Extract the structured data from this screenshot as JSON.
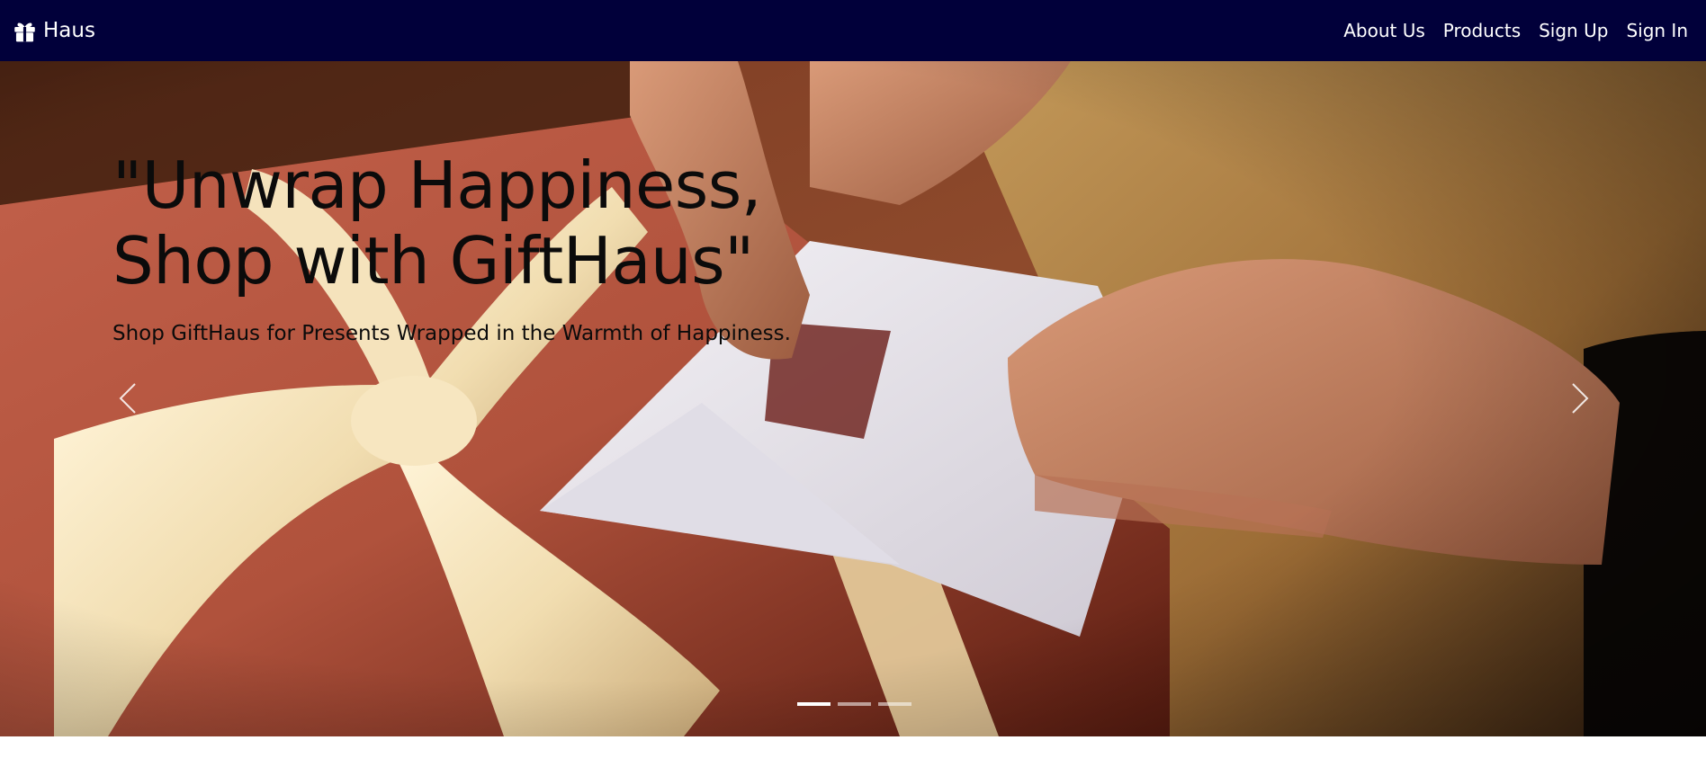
{
  "brand": {
    "icon": "gift-icon",
    "label": "Haus"
  },
  "nav": {
    "items": [
      {
        "label": "About Us"
      },
      {
        "label": "Products"
      },
      {
        "label": "Sign Up"
      },
      {
        "label": "Sign In"
      }
    ]
  },
  "hero": {
    "headline": "\"Unwrap Happiness, Shop with GiftHaus\"",
    "subline": "Shop GiftHaus for Presents Wrapped in the Warmth of Happiness.",
    "image": "gift-envelope-hands-photo",
    "prev_icon": "chevron-left-icon",
    "next_icon": "chevron-right-icon",
    "slides_total": 3,
    "active_slide": 1
  },
  "colors": {
    "navbar_bg": "#01003a",
    "nav_text": "#ffffff",
    "headline_text": "#0b0b0b"
  }
}
